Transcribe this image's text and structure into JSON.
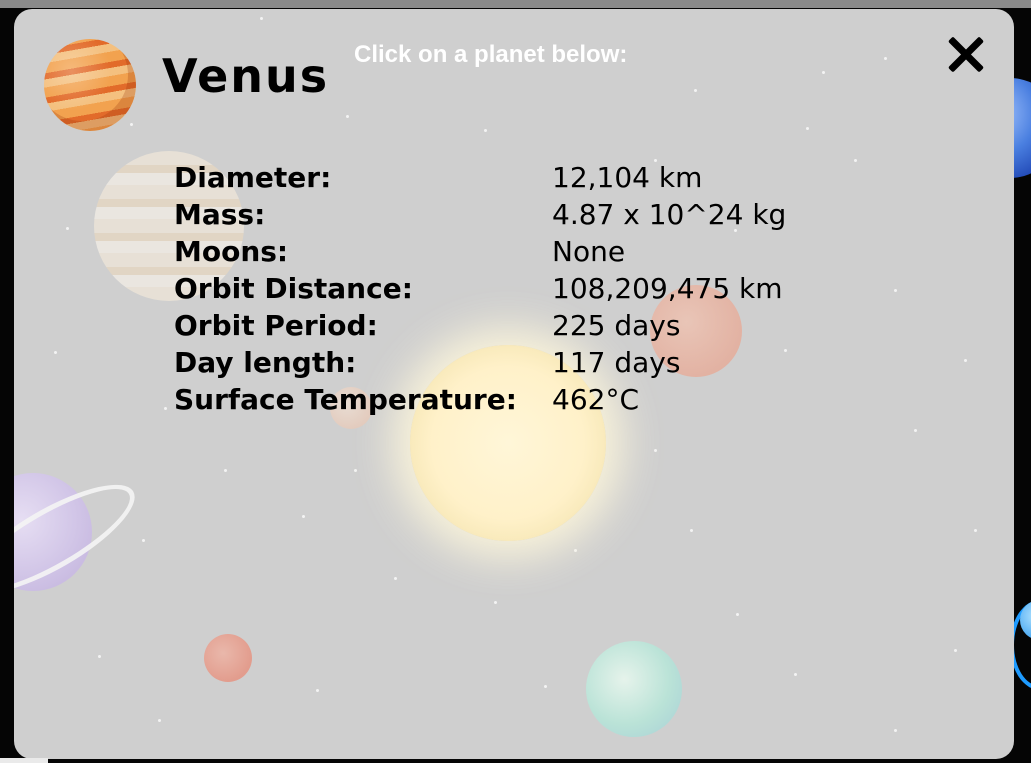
{
  "modal": {
    "instruction": "Click on a planet below:",
    "planet_name": "Venus",
    "close_symbol": "",
    "facts": [
      {
        "label": "Diameter:",
        "value": "12,104 km"
      },
      {
        "label": "Mass:",
        "value": "4.87 x 10^24 kg"
      },
      {
        "label": "Moons:",
        "value": "None"
      },
      {
        "label": "Orbit Distance:",
        "value": "108,209,475 km"
      },
      {
        "label": "Orbit Period:",
        "value": "225 days"
      },
      {
        "label": "Day length:",
        "value": "117 days"
      },
      {
        "label": "Surface Temperature:",
        "value": "462°C"
      }
    ]
  },
  "icons": {
    "planet_icon": "venus-icon",
    "close_icon": "close-icon"
  },
  "colors": {
    "modal_background": "#cfcfcf",
    "text": "#000000",
    "instruction_text": "#ffffff"
  }
}
